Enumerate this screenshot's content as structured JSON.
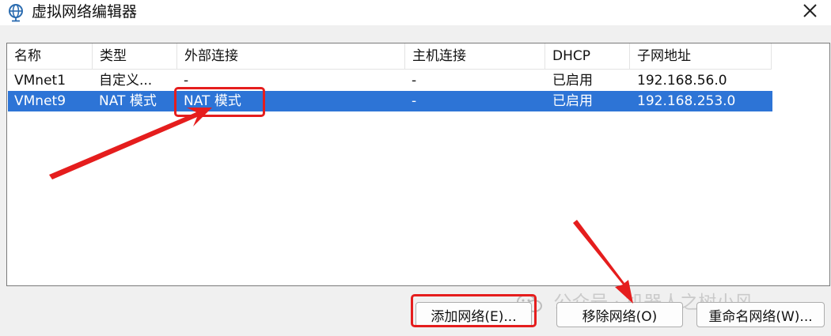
{
  "window": {
    "title": "虚拟网络编辑器",
    "icon": "globe-icon",
    "close_icon": "close-icon"
  },
  "table": {
    "columns": [
      "名称",
      "类型",
      "外部连接",
      "主机连接",
      "DHCP",
      "子网地址"
    ],
    "rows": [
      [
        "VMnet1",
        "自定义...",
        "-",
        "-",
        "已启用",
        "192.168.56.0"
      ],
      [
        "VMnet9",
        "NAT 模式",
        "NAT 模式",
        "-",
        "已启用",
        "192.168.253.0"
      ]
    ],
    "selected_row": 1
  },
  "buttons": {
    "add": "添加网络(E)...",
    "remove": "移除网络(O)",
    "rename": "重命名网络(W)..."
  },
  "watermark": {
    "text": "公众号 · 机器人之树小风",
    "icon": "wechat-icon"
  },
  "colors": {
    "selection": "#2d74d6",
    "annotation": "#e51d1d"
  }
}
